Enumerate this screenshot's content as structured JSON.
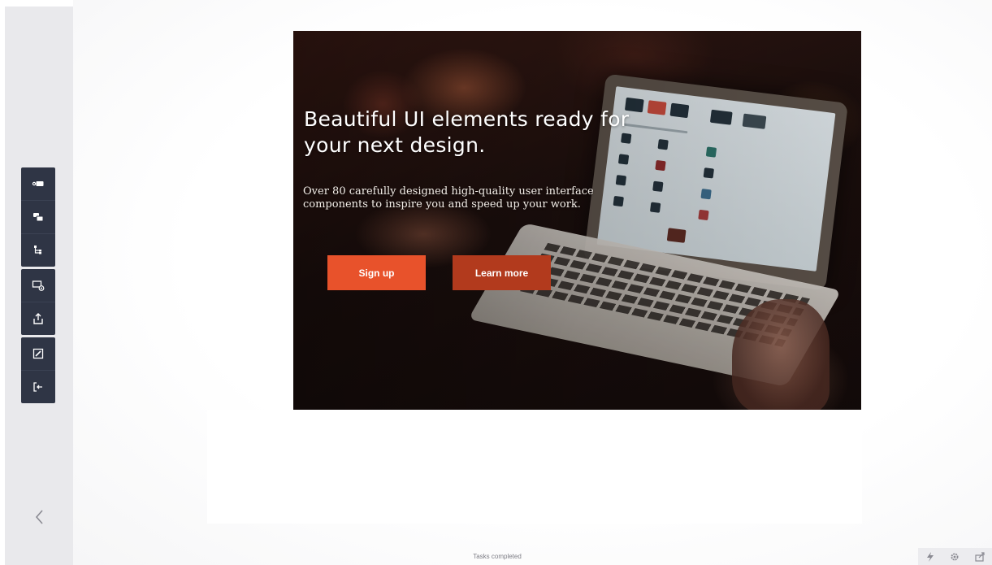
{
  "toolbar": {
    "groups": [
      {
        "tools": [
          "tag-icon",
          "layers-icon",
          "hierarchy-icon"
        ]
      },
      {
        "tools": [
          "preview-icon",
          "export-icon"
        ]
      },
      {
        "tools": [
          "edit-icon",
          "exit-icon"
        ]
      }
    ],
    "collapse_glyph": "<"
  },
  "hero": {
    "title": "Beautiful UI elements ready for your next design.",
    "subtitle": "Over 80 carefully designed high-quality user interface components to inspire you and speed up your work.",
    "primary_cta": "Sign up",
    "secondary_cta": "Learn more",
    "primary_color": "#e8522b",
    "secondary_color": "#b23a1d"
  },
  "status": {
    "text": "Tasks completed"
  },
  "footer": {
    "icons": [
      "lightning-icon",
      "settings-icon",
      "share-icon"
    ]
  },
  "colors": {
    "toolbar_bg": "#2f3545",
    "rail_bg": "#e9e9ec"
  }
}
